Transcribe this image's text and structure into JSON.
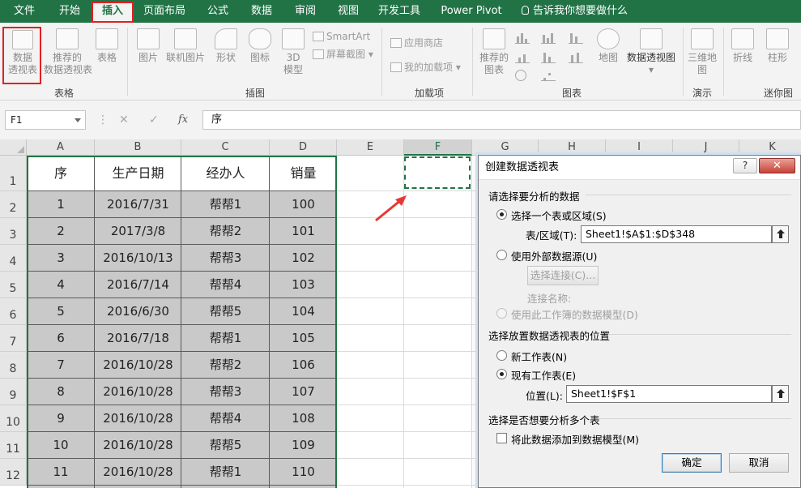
{
  "menu": {
    "tabs": [
      "文件",
      "开始",
      "插入",
      "页面布局",
      "公式",
      "数据",
      "审阅",
      "视图",
      "开发工具",
      "Power Pivot"
    ],
    "active": "插入",
    "tell_me": "告诉我你想要做什么"
  },
  "ribbon": {
    "groups": {
      "tables": "表格",
      "illustrations": "插图",
      "addins": "加载项",
      "charts": "图表",
      "tours": "演示",
      "sparklines": "迷你图"
    },
    "buttons": {
      "pivot": [
        "数据",
        "透视表"
      ],
      "rec_pivot": [
        "推荐的",
        "数据透视表"
      ],
      "table": "表格",
      "pictures": "图片",
      "online_pictures": "联机图片",
      "shapes": "形状",
      "icons": "图标",
      "model3d": [
        "3D",
        "模型"
      ],
      "smartart": "SmartArt",
      "screenshot": "屏幕截图",
      "store": "应用商店",
      "myaddins": "我的加载项",
      "rec_charts": [
        "推荐的",
        "图表"
      ],
      "maps": "地图",
      "pivotchart": "数据透视图",
      "map3d": [
        "三维地",
        "图"
      ],
      "line": "折线",
      "column": "柱形"
    }
  },
  "formula_bar": {
    "name_box": "F1",
    "fx": "fx",
    "content": "序"
  },
  "columns": [
    "A",
    "B",
    "C",
    "D",
    "E",
    "F",
    "G",
    "H",
    "I",
    "J",
    "K"
  ],
  "selected_column": "F",
  "rows": [
    "1",
    "2",
    "3",
    "4",
    "5",
    "6",
    "7",
    "8",
    "9",
    "10",
    "11",
    "12"
  ],
  "table": {
    "headers": [
      "序",
      "生产日期",
      "经办人",
      "销量"
    ],
    "rows": [
      [
        "1",
        "2016/7/31",
        "帮帮1",
        "100"
      ],
      [
        "2",
        "2017/3/8",
        "帮帮2",
        "101"
      ],
      [
        "3",
        "2016/10/13",
        "帮帮3",
        "102"
      ],
      [
        "4",
        "2016/7/14",
        "帮帮4",
        "103"
      ],
      [
        "5",
        "2016/6/30",
        "帮帮5",
        "104"
      ],
      [
        "6",
        "2016/7/18",
        "帮帮1",
        "105"
      ],
      [
        "7",
        "2016/10/28",
        "帮帮2",
        "106"
      ],
      [
        "8",
        "2016/10/28",
        "帮帮3",
        "107"
      ],
      [
        "9",
        "2016/10/28",
        "帮帮4",
        "108"
      ],
      [
        "10",
        "2016/10/28",
        "帮帮5",
        "109"
      ],
      [
        "11",
        "2016/10/28",
        "帮帮1",
        "110"
      ]
    ]
  },
  "dialog": {
    "title": "创建数据透视表",
    "help": "?",
    "close": "✕",
    "section1": "请选择要分析的数据",
    "opt_range": "选择一个表或区域(S)",
    "range_label": "表/区域(T):",
    "range_value": "Sheet1!$A$1:$D$348",
    "opt_external": "使用外部数据源(U)",
    "choose_conn": "选择连接(C)...",
    "conn_name": "连接名称:",
    "opt_model": "使用此工作簿的数据模型(D)",
    "section2": "选择放置数据透视表的位置",
    "opt_new": "新工作表(N)",
    "opt_existing": "现有工作表(E)",
    "location_label": "位置(L):",
    "location_value": "Sheet1!$F$1",
    "section3": "选择是否想要分析多个表",
    "add_model": "将此数据添加到数据模型(M)",
    "ok": "确定",
    "cancel": "取消"
  }
}
